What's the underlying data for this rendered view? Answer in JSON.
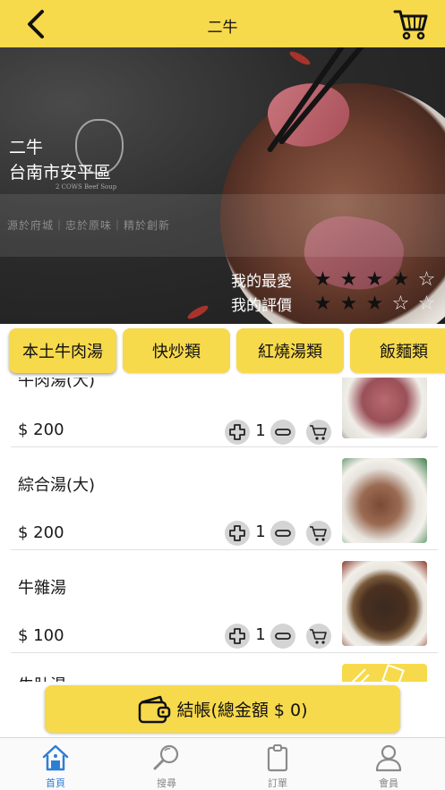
{
  "header": {
    "title": "二牛",
    "back_icon": "chevron-left-icon",
    "cart_icon": "shopping-cart-icon"
  },
  "hero": {
    "store_name": "二牛",
    "store_area": "台南市安平區",
    "logo_caption": "2 COWS Beef Soup",
    "motto": "源於府城｜忠於原味｜精於創新",
    "favorite_label": "我的最愛",
    "favorite_stars": 4,
    "review_label": "我的評價",
    "review_stars": 3,
    "max_stars": 5
  },
  "tabs": [
    {
      "label": "本土牛肉湯"
    },
    {
      "label": "快炒類"
    },
    {
      "label": "紅燒湯類"
    },
    {
      "label": "飯麵類"
    }
  ],
  "items": [
    {
      "name": "牛肉湯(大)",
      "price": "$ 200",
      "qty": "1"
    },
    {
      "name": "綜合湯(大)",
      "price": "$ 200",
      "qty": "1"
    },
    {
      "name": "牛雜湯",
      "price": "$ 100",
      "qty": "1"
    },
    {
      "name": "牛肚湯",
      "price": "",
      "qty": ""
    }
  ],
  "checkout": {
    "label": "結帳(總金額 $ 0)",
    "icon": "wallet-icon"
  },
  "bottom_nav": [
    {
      "label": "首頁",
      "icon": "home-icon",
      "active": true
    },
    {
      "label": "搜尋",
      "icon": "search-icon",
      "active": false
    },
    {
      "label": "訂單",
      "icon": "clipboard-icon",
      "active": false
    },
    {
      "label": "會員",
      "icon": "user-icon",
      "active": false
    }
  ],
  "colors": {
    "accent": "#f7d94c",
    "nav_active": "#2d7fd6",
    "nav_inactive": "#888888"
  }
}
